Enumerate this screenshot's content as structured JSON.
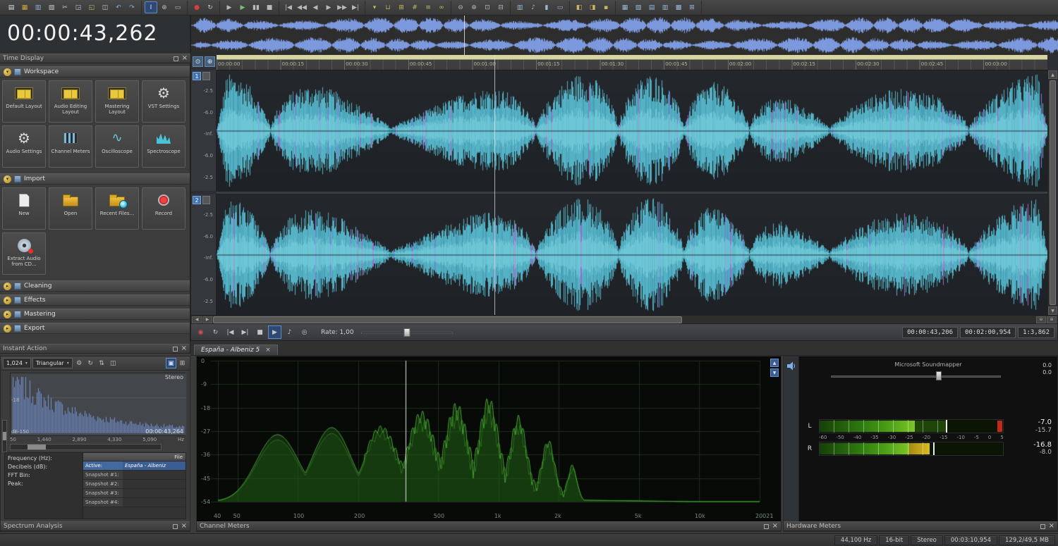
{
  "icons": {
    "dropdown": "▾",
    "arrow_expanded": "▾",
    "arrow_collapsed": "▸",
    "gear": "⚙",
    "scope": "∿",
    "close": "×",
    "scroll_left": "◀",
    "scroll_right": "▶",
    "scroll_up": "▲",
    "scroll_down": "▼",
    "zoom_in": "⊕",
    "zoom_out": "⊖",
    "corner_tools": [
      {
        "name": "scrub-tool-icon",
        "glyph": "⊙"
      },
      {
        "name": "magnify-icon",
        "glyph": "⊕"
      }
    ],
    "cm_scroll": [
      {
        "name": "scroll-up-icon",
        "glyph": "▲"
      },
      {
        "name": "scroll-down-icon",
        "glyph": "▼"
      }
    ]
  },
  "toolbar": {
    "groups": [
      [
        {
          "name": "new-file-icon",
          "glyph": "▤",
          "color": "#e0e0e0"
        },
        {
          "name": "open-file-icon",
          "glyph": "▦",
          "color": "#d0a838"
        },
        {
          "name": "save-icon",
          "glyph": "▥",
          "color": "#8fb0d8"
        },
        {
          "name": "publish-icon",
          "glyph": "▧",
          "color": "#c8c8c8"
        },
        {
          "name": "cut-icon",
          "glyph": "✂",
          "color": "#c8c8c8"
        },
        {
          "name": "copy-icon",
          "glyph": "◲",
          "color": "#c8c8c8"
        },
        {
          "name": "paste-icon",
          "glyph": "◱",
          "color": "#c8b860"
        },
        {
          "name": "trim-icon",
          "glyph": "◫",
          "color": "#c8c8c8"
        },
        {
          "name": "undo-icon",
          "glyph": "↶",
          "color": "#80b0e0"
        },
        {
          "name": "redo-icon",
          "glyph": "↷",
          "color": "#80b0e0"
        }
      ],
      [
        {
          "name": "edit-tool-icon",
          "glyph": "I",
          "highlight": true
        },
        {
          "name": "magnify-tool-icon",
          "glyph": "⊕"
        },
        {
          "name": "selection-tool-icon",
          "glyph": "▭"
        }
      ],
      [
        {
          "name": "record-icon",
          "glyph": "●",
          "color": "#d84040"
        },
        {
          "name": "loop-playback-icon",
          "glyph": "↻",
          "color": "#c8c8c8"
        }
      ],
      [
        {
          "name": "play-all-icon",
          "glyph": "▶"
        },
        {
          "name": "play-icon",
          "glyph": "▶",
          "color": "#78c078"
        },
        {
          "name": "pause-icon",
          "glyph": "▮▮"
        },
        {
          "name": "stop-icon",
          "glyph": "■"
        }
      ],
      [
        {
          "name": "go-to-start-icon",
          "glyph": "|◀"
        },
        {
          "name": "rewind-icon",
          "glyph": "◀◀"
        },
        {
          "name": "step-back-icon",
          "glyph": "◀"
        },
        {
          "name": "step-forward-icon",
          "glyph": "▶"
        },
        {
          "name": "fast-forward-icon",
          "glyph": "▶▶"
        },
        {
          "name": "go-to-end-icon",
          "glyph": "▶|"
        }
      ],
      [
        {
          "name": "marker-icon",
          "glyph": "▾",
          "color": "#c9b760"
        },
        {
          "name": "region-icon",
          "glyph": "⊔",
          "color": "#c9b760"
        },
        {
          "name": "command-icon",
          "glyph": "⊞",
          "color": "#c9b760"
        },
        {
          "name": "snap-icon",
          "glyph": "#",
          "color": "#c9b760"
        },
        {
          "name": "ripple-icon",
          "glyph": "≡",
          "color": "#c9b760"
        },
        {
          "name": "crossfade-icon",
          "glyph": "∞",
          "color": "#c9b760"
        }
      ],
      [
        {
          "name": "zoom-out-icon",
          "glyph": "⊖"
        },
        {
          "name": "zoom-in-icon",
          "glyph": "⊕"
        },
        {
          "name": "zoom-selection-icon",
          "glyph": "⊡"
        },
        {
          "name": "zoom-all-icon",
          "glyph": "⊟"
        }
      ],
      [
        {
          "name": "mixer-icon",
          "glyph": "▥",
          "color": "#9ab8d8"
        },
        {
          "name": "plugin-chain-icon",
          "glyph": "♪",
          "color": "#9ab8d8"
        },
        {
          "name": "hardware-meters-icon",
          "glyph": "▮",
          "color": "#9ab8d8"
        },
        {
          "name": "video-preview-icon",
          "glyph": "▭",
          "color": "#9ab8d8"
        }
      ],
      [
        {
          "name": "docking-icon",
          "glyph": "◧",
          "color": "#c9b760"
        },
        {
          "name": "explorer-icon",
          "glyph": "◨",
          "color": "#c9b760"
        },
        {
          "name": "lock-icon",
          "glyph": "▪",
          "color": "#c9b760"
        }
      ],
      [
        {
          "name": "workspace-a-icon",
          "glyph": "▦",
          "color": "#9ab8d8"
        },
        {
          "name": "workspace-b-icon",
          "glyph": "▧",
          "color": "#9ab8d8"
        },
        {
          "name": "workspace-c-icon",
          "glyph": "▤",
          "color": "#9ab8d8"
        },
        {
          "name": "workspace-d-icon",
          "glyph": "▥",
          "color": "#9ab8d8"
        },
        {
          "name": "workspace-e-icon",
          "glyph": "▩",
          "color": "#9ab8d8"
        },
        {
          "name": "workspace-f-icon",
          "glyph": "⊞",
          "color": "#9ab8d8"
        }
      ]
    ]
  },
  "time_display": {
    "title": "Time Display",
    "value": "00:00:43,262"
  },
  "task_pane": {
    "footer_title": "Instant Action",
    "sections": [
      {
        "label": "Workspace",
        "expanded": true,
        "items": [
          {
            "label": "Default Layout",
            "icon": "layout"
          },
          {
            "label": "Audio Editing Layout",
            "icon": "layout"
          },
          {
            "label": "Mastering Layout",
            "icon": "layout"
          },
          {
            "label": "VST Settings",
            "icon": "gear"
          },
          {
            "label": "Audio Settings",
            "icon": "gear"
          },
          {
            "label": "Channel Meters",
            "icon": "meters"
          },
          {
            "label": "Oscilloscope",
            "icon": "scope"
          },
          {
            "label": "Spectroscope",
            "icon": "spectro"
          }
        ]
      },
      {
        "label": "Import",
        "expanded": true,
        "items": [
          {
            "label": "New",
            "icon": "page"
          },
          {
            "label": "Open",
            "icon": "folder"
          },
          {
            "label": "Recent Files...",
            "icon": "folder-clock"
          },
          {
            "label": "Record",
            "icon": "record"
          },
          {
            "label": "Extract Audio from CD...",
            "icon": "cd"
          }
        ]
      },
      {
        "label": "Cleaning",
        "expanded": false,
        "items": []
      },
      {
        "label": "Effects",
        "expanded": false,
        "items": []
      },
      {
        "label": "Mastering",
        "expanded": false,
        "items": []
      },
      {
        "label": "Export",
        "expanded": false,
        "items": []
      }
    ]
  },
  "editor": {
    "ruler_times": [
      "00:00:00",
      "00:00:15",
      "00:00:30",
      "00:00:45",
      "00:01:00",
      "00:01:15",
      "00:01:30",
      "00:01:45",
      "00:02:00",
      "00:02:15",
      "00:02:30",
      "00:02:45",
      "00:03:00"
    ],
    "channels": [
      {
        "number": "1",
        "db_labels": [
          "-2.5",
          "-6.0",
          "-Inf.",
          "-6.0",
          "-2.5"
        ]
      },
      {
        "number": "2",
        "db_labels": [
          "-2.5",
          "-6.0",
          "-Inf.",
          "-6.0",
          "-2.5"
        ]
      }
    ],
    "tab_label": "España - Albeniz 5"
  },
  "transport": {
    "icons": [
      {
        "name": "record-icon",
        "glyph": "◉",
        "color": "#d85050"
      },
      {
        "name": "loop-icon",
        "glyph": "↻"
      },
      {
        "name": "go-to-start-icon",
        "glyph": "|◀"
      },
      {
        "name": "go-to-end-icon",
        "glyph": "▶|"
      },
      {
        "name": "stop-icon",
        "glyph": "■"
      },
      {
        "name": "play-icon",
        "glyph": "▶",
        "highlight": true
      },
      {
        "name": "play-device-icon",
        "glyph": "♪"
      },
      {
        "name": "monitor-icon",
        "glyph": "◎"
      }
    ],
    "rate_label": "Rate: 1,00",
    "readouts": [
      "00:00:43,206",
      "00:02:00,954",
      "1:3,862"
    ]
  },
  "spectrum_analysis": {
    "fft_size": "1,024",
    "window_type": "Triangular",
    "icons": [
      {
        "name": "settings-gear-icon",
        "glyph": "⚙"
      },
      {
        "name": "refresh-icon",
        "glyph": "↻"
      },
      {
        "name": "sort-icon",
        "glyph": "⇅"
      },
      {
        "name": "hold-icon",
        "glyph": "◫"
      }
    ],
    "right_icons": [
      {
        "name": "lock-icon",
        "glyph": "▣",
        "highlight": true
      },
      {
        "name": "grid-icon",
        "glyph": "⊞"
      }
    ],
    "db_label": "-18",
    "floor_label": "dB-150",
    "channel_label": "Stereo",
    "cursor_value": "00:00:43,264",
    "freq_ticks": [
      "50",
      "1,440",
      "2,890",
      "4,330",
      "5,090"
    ],
    "freq_unit": "Hz",
    "info_labels": [
      "Frequency (Hz):",
      "Decibels (dB):",
      "FFT Bin:",
      "Peak:"
    ],
    "table": {
      "header": "File",
      "rows": [
        {
          "label": "Active:",
          "value": "España - Albeniz",
          "active": true
        },
        {
          "label": "Snapshot #1:",
          "value": ""
        },
        {
          "label": "Snapshot #2:",
          "value": ""
        },
        {
          "label": "Snapshot #3:",
          "value": ""
        },
        {
          "label": "Snapshot #4:",
          "value": ""
        }
      ]
    },
    "footer_title": "Spectrum Analysis"
  },
  "channel_meters": {
    "db_ticks": [
      "0",
      "-9",
      "-18",
      "-27",
      "-36",
      "-45",
      "-54"
    ],
    "freq_ticks": [
      {
        "label": "40",
        "pos": 0
      },
      {
        "label": "50",
        "pos": 0.036
      },
      {
        "label": "100",
        "pos": 0.147
      },
      {
        "label": "200",
        "pos": 0.259
      },
      {
        "label": "500",
        "pos": 0.406
      },
      {
        "label": "1k",
        "pos": 0.518
      },
      {
        "label": "2k",
        "pos": 0.629
      },
      {
        "label": "5k",
        "pos": 0.777
      },
      {
        "label": "10k",
        "pos": 0.888
      },
      {
        "label": "20021",
        "pos": 1
      }
    ],
    "footer_title": "Channel Meters"
  },
  "hardware_meters": {
    "device": "Microsoft Soundmapper",
    "gain_values": [
      "0.0",
      "0.0"
    ],
    "scale": [
      "-60",
      "-50",
      "-40",
      "-35",
      "-30",
      "-25",
      "-20",
      "-15",
      "-10",
      "-5",
      "0",
      "5"
    ],
    "meters": [
      {
        "channel": "L",
        "peak_db": "-7.0",
        "rms_db": "-15.7",
        "fill": 52,
        "ext": 69,
        "peak": 69,
        "red": true,
        "yellow": false
      },
      {
        "channel": "R",
        "peak_db": "-16.8",
        "rms_db": "-8.0",
        "fill": 49,
        "ext": 60,
        "peak": 62,
        "red": false,
        "yellow": true
      }
    ],
    "footer_title": "Hardware Meters"
  },
  "status_bar": {
    "items": [
      {
        "name": "sample-rate",
        "text": "44,100 Hz"
      },
      {
        "name": "bit-depth",
        "text": "16-bit"
      },
      {
        "name": "channel-mode",
        "text": "Stereo"
      },
      {
        "name": "file-length",
        "text": "00:03:10,954"
      },
      {
        "name": "storage",
        "text": "129,2/49,5 MB"
      }
    ]
  }
}
